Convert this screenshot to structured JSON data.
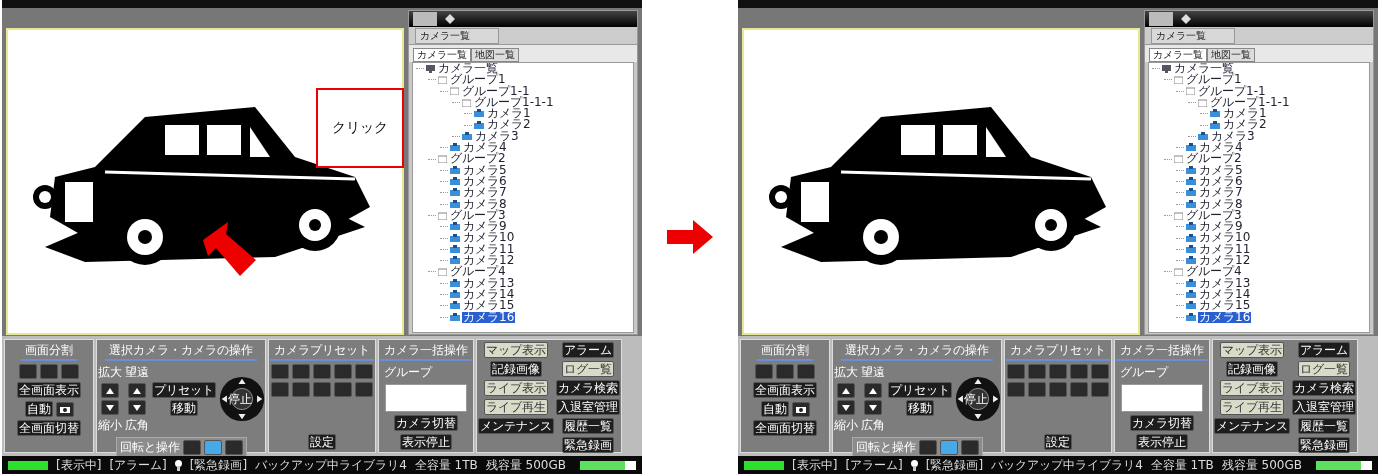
{
  "screens": [
    {
      "callout": {
        "text": "クリック"
      },
      "panel_title": "カメラ一覧",
      "tabs": [
        {
          "label": "カメラ一覧",
          "selected": true
        },
        {
          "label": "地図一覧",
          "selected": false
        }
      ],
      "tree": [
        {
          "label": "カメラ一覧",
          "kind": "root",
          "selected": false,
          "children": [
            {
              "label": "グループ1",
              "kind": "group",
              "selected": false,
              "children": [
                {
                  "label": "グループ1-1",
                  "kind": "group",
                  "selected": false,
                  "children": [
                    {
                      "label": "グループ1-1-1",
                      "kind": "group",
                      "selected": false,
                      "children": [
                        {
                          "label": "カメラ1",
                          "kind": "camera",
                          "selected": false
                        },
                        {
                          "label": "カメラ2",
                          "kind": "camera",
                          "selected": false
                        }
                      ]
                    },
                    {
                      "label": "カメラ3",
                      "kind": "camera",
                      "selected": false
                    }
                  ]
                },
                {
                  "label": "カメラ4",
                  "kind": "camera",
                  "selected": false
                }
              ]
            },
            {
              "label": "グループ2",
              "kind": "group",
              "selected": false,
              "children": [
                {
                  "label": "カメラ5",
                  "kind": "camera",
                  "selected": false
                },
                {
                  "label": "カメラ6",
                  "kind": "camera",
                  "selected": false
                },
                {
                  "label": "カメラ7",
                  "kind": "camera",
                  "selected": false
                },
                {
                  "label": "カメラ8",
                  "kind": "camera",
                  "selected": false
                }
              ]
            },
            {
              "label": "グループ3",
              "kind": "group",
              "selected": false,
              "children": [
                {
                  "label": "カメラ9",
                  "kind": "camera",
                  "selected": false
                },
                {
                  "label": "カメラ10",
                  "kind": "camera",
                  "selected": false
                },
                {
                  "label": "カメラ11",
                  "kind": "camera",
                  "selected": false
                },
                {
                  "label": "カメラ12",
                  "kind": "camera",
                  "selected": false
                }
              ]
            },
            {
              "label": "グループ4",
              "kind": "group",
              "selected": false,
              "children": [
                {
                  "label": "カメラ13",
                  "kind": "camera",
                  "selected": false
                },
                {
                  "label": "カメラ14",
                  "kind": "camera",
                  "selected": false
                },
                {
                  "label": "カメラ15",
                  "kind": "camera",
                  "selected": false
                },
                {
                  "label": "カメラ16",
                  "kind": "camera",
                  "selected": true
                }
              ]
            }
          ]
        }
      ],
      "controls": {
        "layout": {
          "title": "画面分割",
          "buttons": [
            "全画面表示",
            "自動",
            "全画面切替"
          ]
        },
        "camera": {
          "title": "選択カメラ・カメラの操作",
          "top_labels": [
            "拡大",
            "望遠"
          ],
          "bottom_labels": [
            "縮小",
            "広角"
          ],
          "buttons": [
            "プリセット",
            "移動"
          ],
          "center": "停止",
          "rotate_label": "回転と操作",
          "modes": [
            {
              "selected": false
            },
            {
              "selected": true
            },
            {
              "selected": false
            }
          ]
        },
        "preset": {
          "title": "カメラプリセット",
          "button": "設定"
        },
        "batch": {
          "title": "カメラ一括操作",
          "group_label": "グループ",
          "buttons": [
            "カメラ切替",
            "表示停止"
          ]
        },
        "menu": {
          "left": [
            {
              "label": "マップ表示",
              "selected": true
            },
            {
              "label": "記録画像",
              "selected": false
            },
            {
              "label": "ライブ表示",
              "selected": true
            },
            {
              "label": "ライブ再生",
              "selected": true
            },
            {
              "label": "メンテナンス",
              "selected": false
            }
          ],
          "right": [
            {
              "label": "アラーム",
              "selected": false
            },
            {
              "label": "ログ一覧",
              "selected": true
            },
            {
              "label": "カメラ検索",
              "selected": false
            },
            {
              "label": "入退室管理",
              "selected": false
            },
            {
              "label": "履歴一覧",
              "selected": false
            },
            {
              "label": "緊急録画",
              "selected": false
            }
          ]
        }
      },
      "status": {
        "display": "[表示中]",
        "alarm": "[アラーム]",
        "record": "[緊急録画]",
        "backup": "バックアップ中ライブラリ4",
        "total": "全容量 1TB",
        "free": "残容量 500GB",
        "usage": {
          "level": 0.8
        }
      }
    },
    {
      "panel_title": "カメラ一覧",
      "tabs": [
        {
          "label": "カメラ一覧",
          "selected": true
        },
        {
          "label": "地図一覧",
          "selected": false
        }
      ],
      "tree": [
        {
          "label": "カメラ一覧",
          "kind": "root",
          "selected": false,
          "children": [
            {
              "label": "グループ1",
              "kind": "group",
              "selected": false,
              "children": [
                {
                  "label": "グループ1-1",
                  "kind": "group",
                  "selected": false,
                  "children": [
                    {
                      "label": "グループ1-1-1",
                      "kind": "group",
                      "selected": false,
                      "children": [
                        {
                          "label": "カメラ1",
                          "kind": "camera",
                          "selected": false
                        },
                        {
                          "label": "カメラ2",
                          "kind": "camera",
                          "selected": false
                        }
                      ]
                    },
                    {
                      "label": "カメラ3",
                      "kind": "camera",
                      "selected": false
                    }
                  ]
                },
                {
                  "label": "カメラ4",
                  "kind": "camera",
                  "selected": false
                }
              ]
            },
            {
              "label": "グループ2",
              "kind": "group",
              "selected": false,
              "children": [
                {
                  "label": "カメラ5",
                  "kind": "camera",
                  "selected": false
                },
                {
                  "label": "カメラ6",
                  "kind": "camera",
                  "selected": false
                },
                {
                  "label": "カメラ7",
                  "kind": "camera",
                  "selected": false
                },
                {
                  "label": "カメラ8",
                  "kind": "camera",
                  "selected": false
                }
              ]
            },
            {
              "label": "グループ3",
              "kind": "group",
              "selected": false,
              "children": [
                {
                  "label": "カメラ9",
                  "kind": "camera",
                  "selected": false
                },
                {
                  "label": "カメラ10",
                  "kind": "camera",
                  "selected": false
                },
                {
                  "label": "カメラ11",
                  "kind": "camera",
                  "selected": false
                },
                {
                  "label": "カメラ12",
                  "kind": "camera",
                  "selected": false
                }
              ]
            },
            {
              "label": "グループ4",
              "kind": "group",
              "selected": false,
              "children": [
                {
                  "label": "カメラ13",
                  "kind": "camera",
                  "selected": false
                },
                {
                  "label": "カメラ14",
                  "kind": "camera",
                  "selected": false
                },
                {
                  "label": "カメラ15",
                  "kind": "camera",
                  "selected": false
                },
                {
                  "label": "カメラ16",
                  "kind": "camera",
                  "selected": true
                }
              ]
            }
          ]
        }
      ],
      "controls": {
        "layout": {
          "title": "画面分割",
          "buttons": [
            "全画面表示",
            "自動",
            "全画面切替"
          ]
        },
        "camera": {
          "title": "選択カメラ・カメラの操作",
          "top_labels": [
            "拡大",
            "望遠"
          ],
          "bottom_labels": [
            "縮小",
            "広角"
          ],
          "buttons": [
            "プリセット",
            "移動"
          ],
          "center": "停止",
          "rotate_label": "回転と操作",
          "modes": [
            {
              "selected": false
            },
            {
              "selected": true
            },
            {
              "selected": false
            }
          ]
        },
        "preset": {
          "title": "カメラプリセット",
          "button": "設定"
        },
        "batch": {
          "title": "カメラ一括操作",
          "group_label": "グループ",
          "buttons": [
            "カメラ切替",
            "表示停止"
          ]
        },
        "menu": {
          "left": [
            {
              "label": "マップ表示",
              "selected": true
            },
            {
              "label": "記録画像",
              "selected": false
            },
            {
              "label": "ライブ表示",
              "selected": true
            },
            {
              "label": "ライブ再生",
              "selected": true
            },
            {
              "label": "メンテナンス",
              "selected": false
            }
          ],
          "right": [
            {
              "label": "アラーム",
              "selected": false
            },
            {
              "label": "ログ一覧",
              "selected": true
            },
            {
              "label": "カメラ検索",
              "selected": false
            },
            {
              "label": "入退室管理",
              "selected": false
            },
            {
              "label": "履歴一覧",
              "selected": false
            },
            {
              "label": "緊急録画",
              "selected": false
            }
          ]
        }
      },
      "status": {
        "display": "[表示中]",
        "alarm": "[アラーム]",
        "record": "[緊急録画]",
        "backup": "バックアップ中ライブラリ4",
        "total": "全容量 1TB",
        "free": "残容量 500GB",
        "usage": {
          "level": 0.8
        }
      }
    }
  ]
}
